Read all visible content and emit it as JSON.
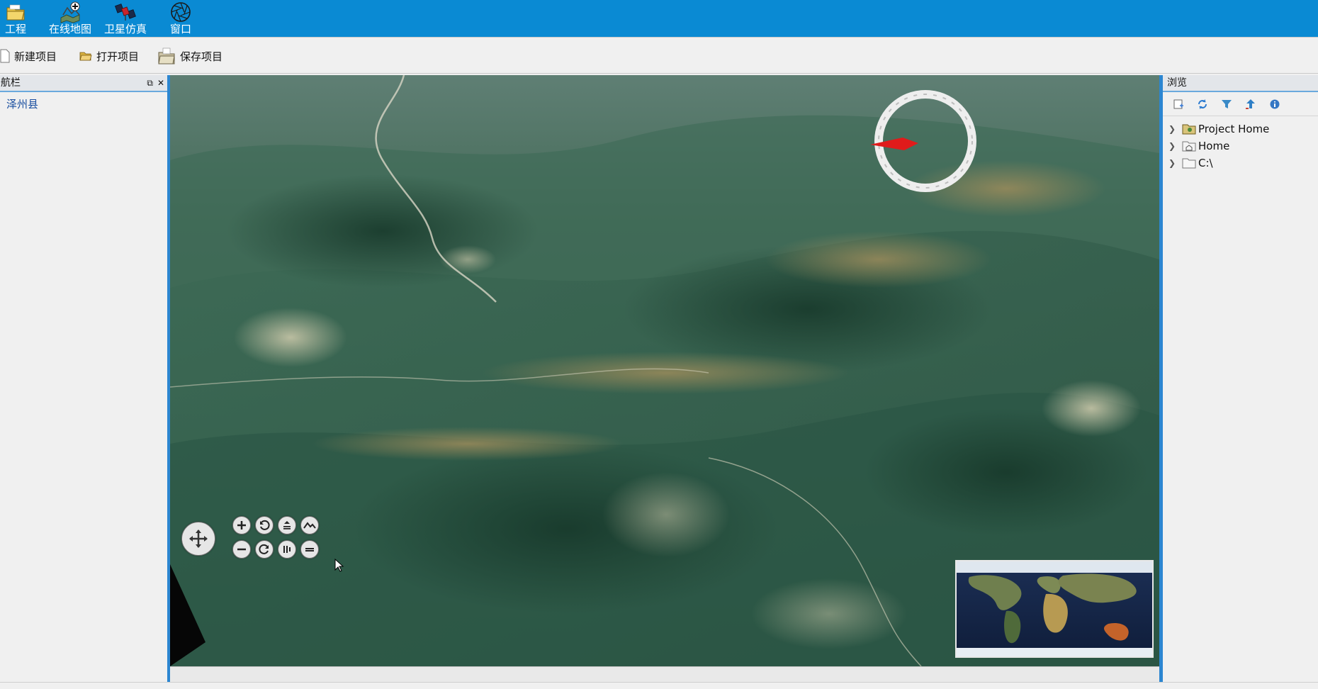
{
  "ribbon": {
    "items": [
      {
        "label": "工程",
        "icon": "folder-icon"
      },
      {
        "label": "在线地图",
        "icon": "online-map-icon"
      },
      {
        "label": "卫星仿真",
        "icon": "satellite-icon"
      },
      {
        "label": "窗口",
        "icon": "aperture-icon"
      }
    ]
  },
  "toolbar": {
    "new_label": "新建项目",
    "open_label": "打开项目",
    "save_label": "保存项目"
  },
  "nav_panel": {
    "title": "航栏",
    "items": [
      "泽州县"
    ]
  },
  "browse_panel": {
    "title": "浏览",
    "tools": [
      "new-icon",
      "refresh-icon",
      "filter-icon",
      "up-icon",
      "info-icon"
    ],
    "tree": [
      {
        "label": "Project Home",
        "icon": "project-folder-icon"
      },
      {
        "label": "Home",
        "icon": "home-icon"
      },
      {
        "label": "C:\\",
        "icon": "folder-icon"
      }
    ]
  },
  "map": {
    "compass": "compass-icon",
    "nav_controls": [
      "zoom-in-icon",
      "rotate-left-icon",
      "tilt-up-icon",
      "terrain-icon",
      "zoom-out-icon",
      "rotate-right-icon",
      "tilt-down-icon",
      "reset-icon"
    ],
    "minimap": "world-overview-map"
  },
  "colors": {
    "ribbon": "#0a8ad3",
    "splitter": "#2c86d1",
    "compass_needle": "#e01b1b"
  }
}
